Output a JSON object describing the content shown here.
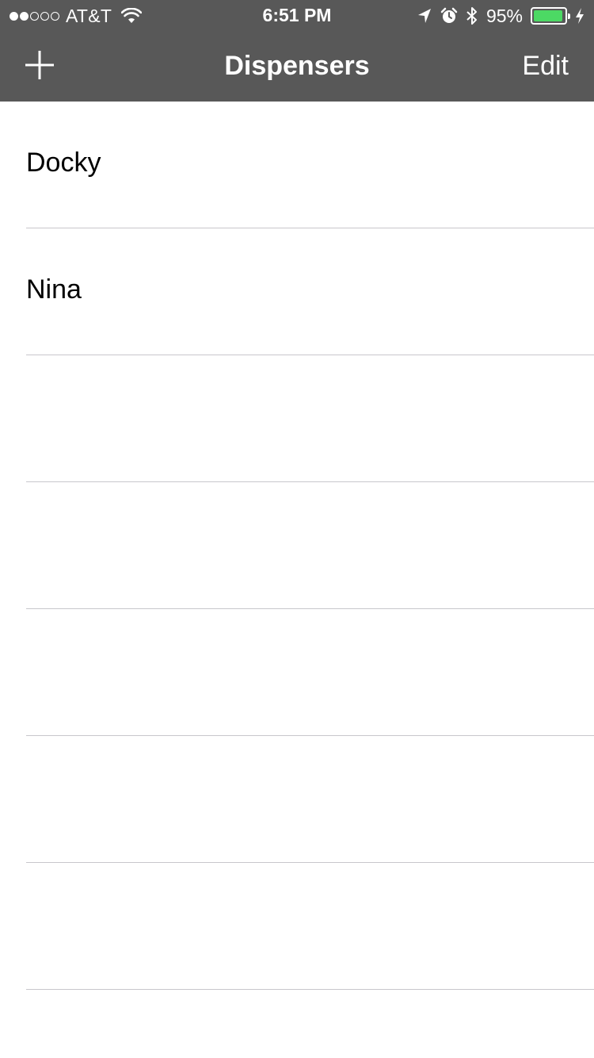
{
  "status_bar": {
    "signal_dots": [
      true,
      true,
      false,
      false,
      false
    ],
    "carrier": "AT&T",
    "time": "6:51 PM",
    "battery_percent": "95%",
    "battery_level": 0.95,
    "icons": [
      "wifi-icon",
      "location-arrow-icon",
      "alarm-icon",
      "bluetooth-icon",
      "battery-icon",
      "charging-bolt-icon"
    ]
  },
  "nav": {
    "title": "Dispensers",
    "add_icon": "plus-icon",
    "edit_label": "Edit"
  },
  "list": {
    "items": [
      {
        "label": "Docky"
      },
      {
        "label": "Nina"
      },
      {
        "label": ""
      },
      {
        "label": ""
      },
      {
        "label": ""
      },
      {
        "label": ""
      },
      {
        "label": ""
      }
    ]
  },
  "colors": {
    "nav_background": "#585858",
    "battery_fill": "#4cd964",
    "separator": "#c8c7cc"
  }
}
